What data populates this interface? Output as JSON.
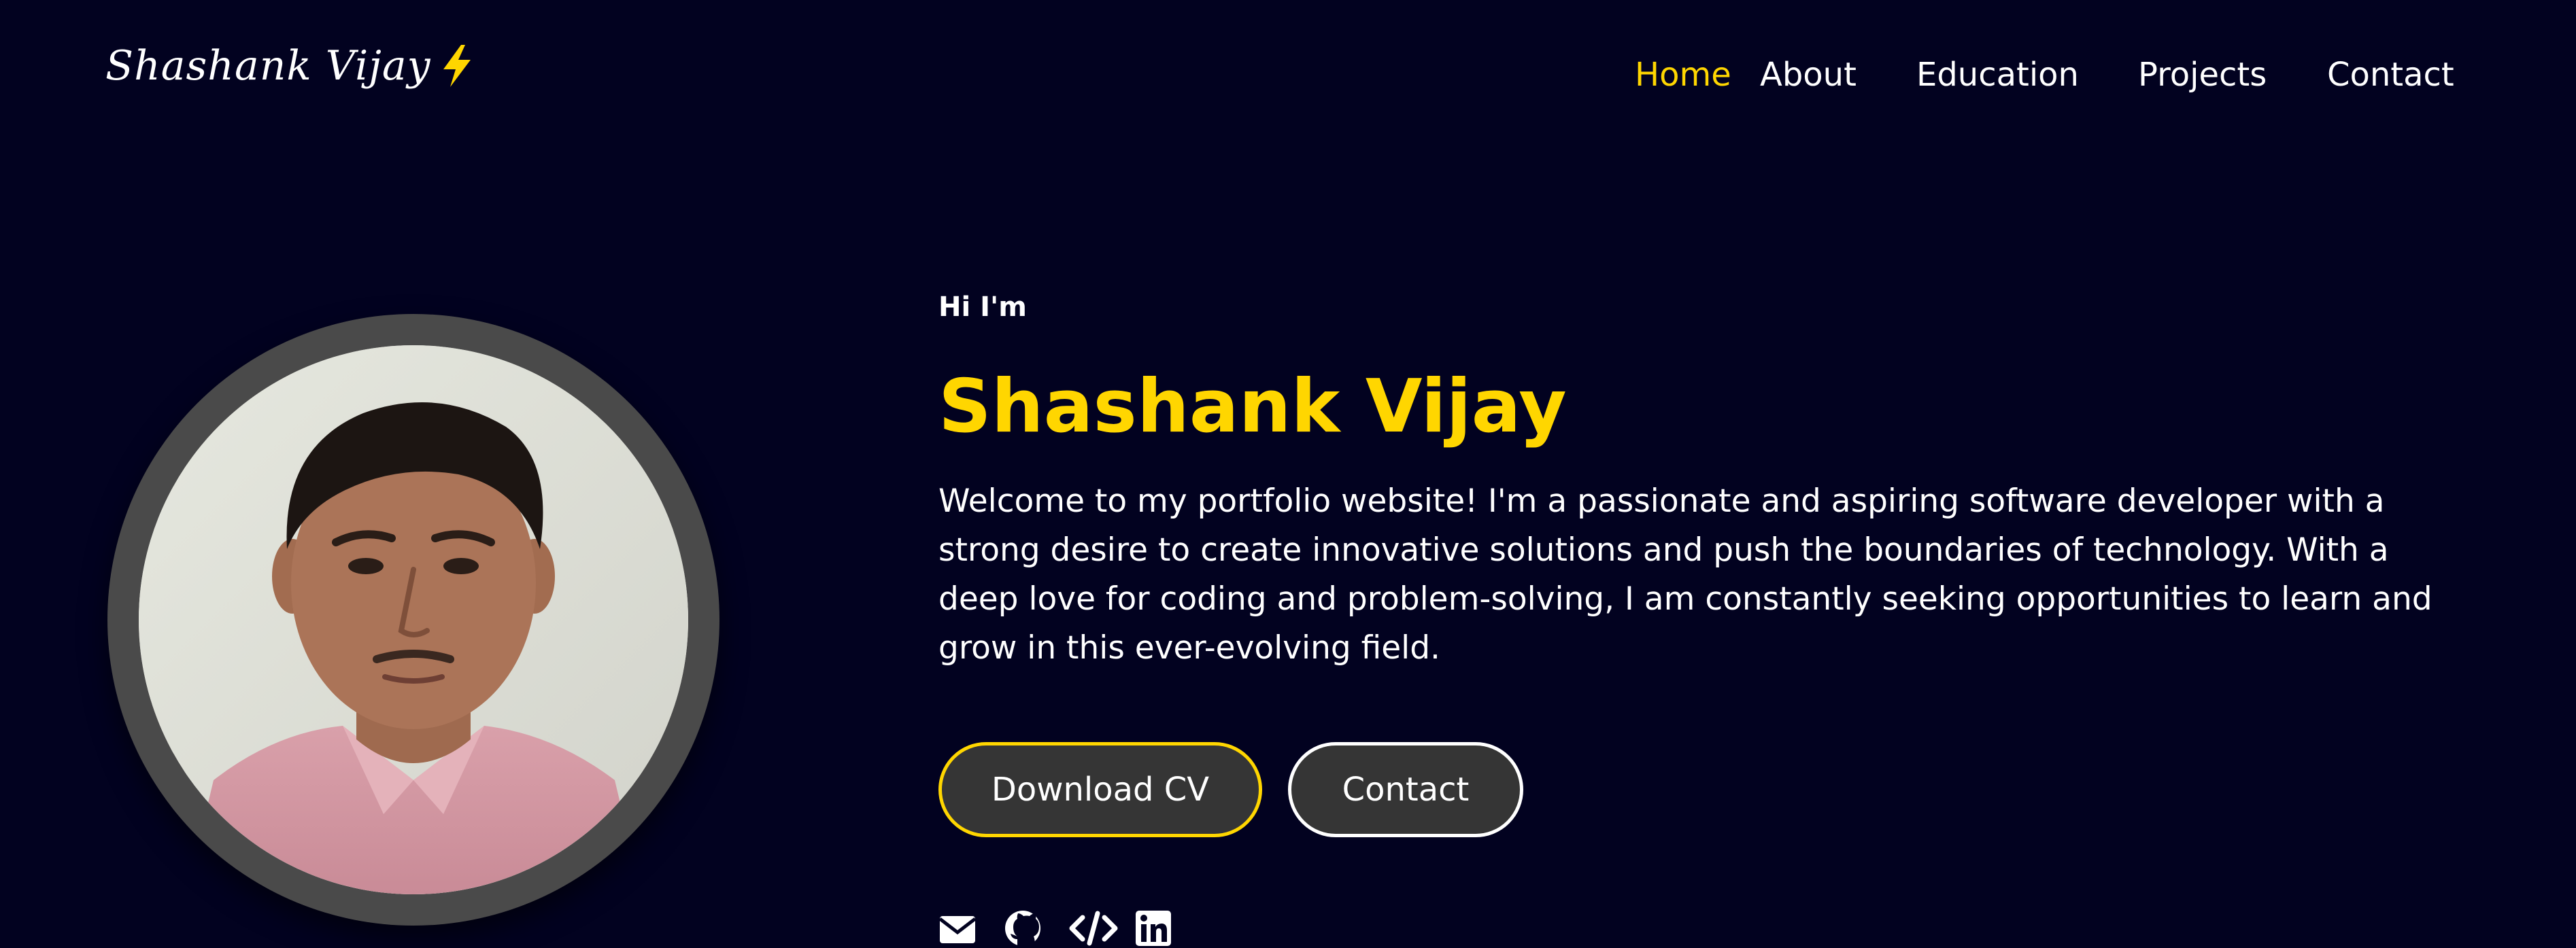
{
  "brand": {
    "name": "Shashank Vijay",
    "icon": "lightning-bolt-icon",
    "icon_color": "#ffd600"
  },
  "nav": {
    "items": [
      {
        "label": "Home",
        "active": true
      },
      {
        "label": "About",
        "active": false
      },
      {
        "label": "Education",
        "active": false
      },
      {
        "label": "Projects",
        "active": false
      },
      {
        "label": "Contact",
        "active": false
      }
    ]
  },
  "hero": {
    "greeting": "Hi I'm",
    "name": "Shashank Vijay",
    "description": "Welcome to my portfolio website! I'm a passionate and aspiring software developer with a strong desire to create innovative solutions and push the boundaries of technology. With a deep love for coding and problem-solving, I am constantly seeking opportunities to learn and grow in this ever-evolving field."
  },
  "buttons": {
    "download_cv": "Download CV",
    "contact": "Contact"
  },
  "socials": [
    {
      "icon": "envelope-icon"
    },
    {
      "icon": "github-icon"
    },
    {
      "icon": "code-icon"
    },
    {
      "icon": "linkedin-icon"
    }
  ],
  "colors": {
    "background": "#020220",
    "accent": "#ffd600",
    "button_bg": "#353535",
    "avatar_ring": "#4a4a4a"
  }
}
